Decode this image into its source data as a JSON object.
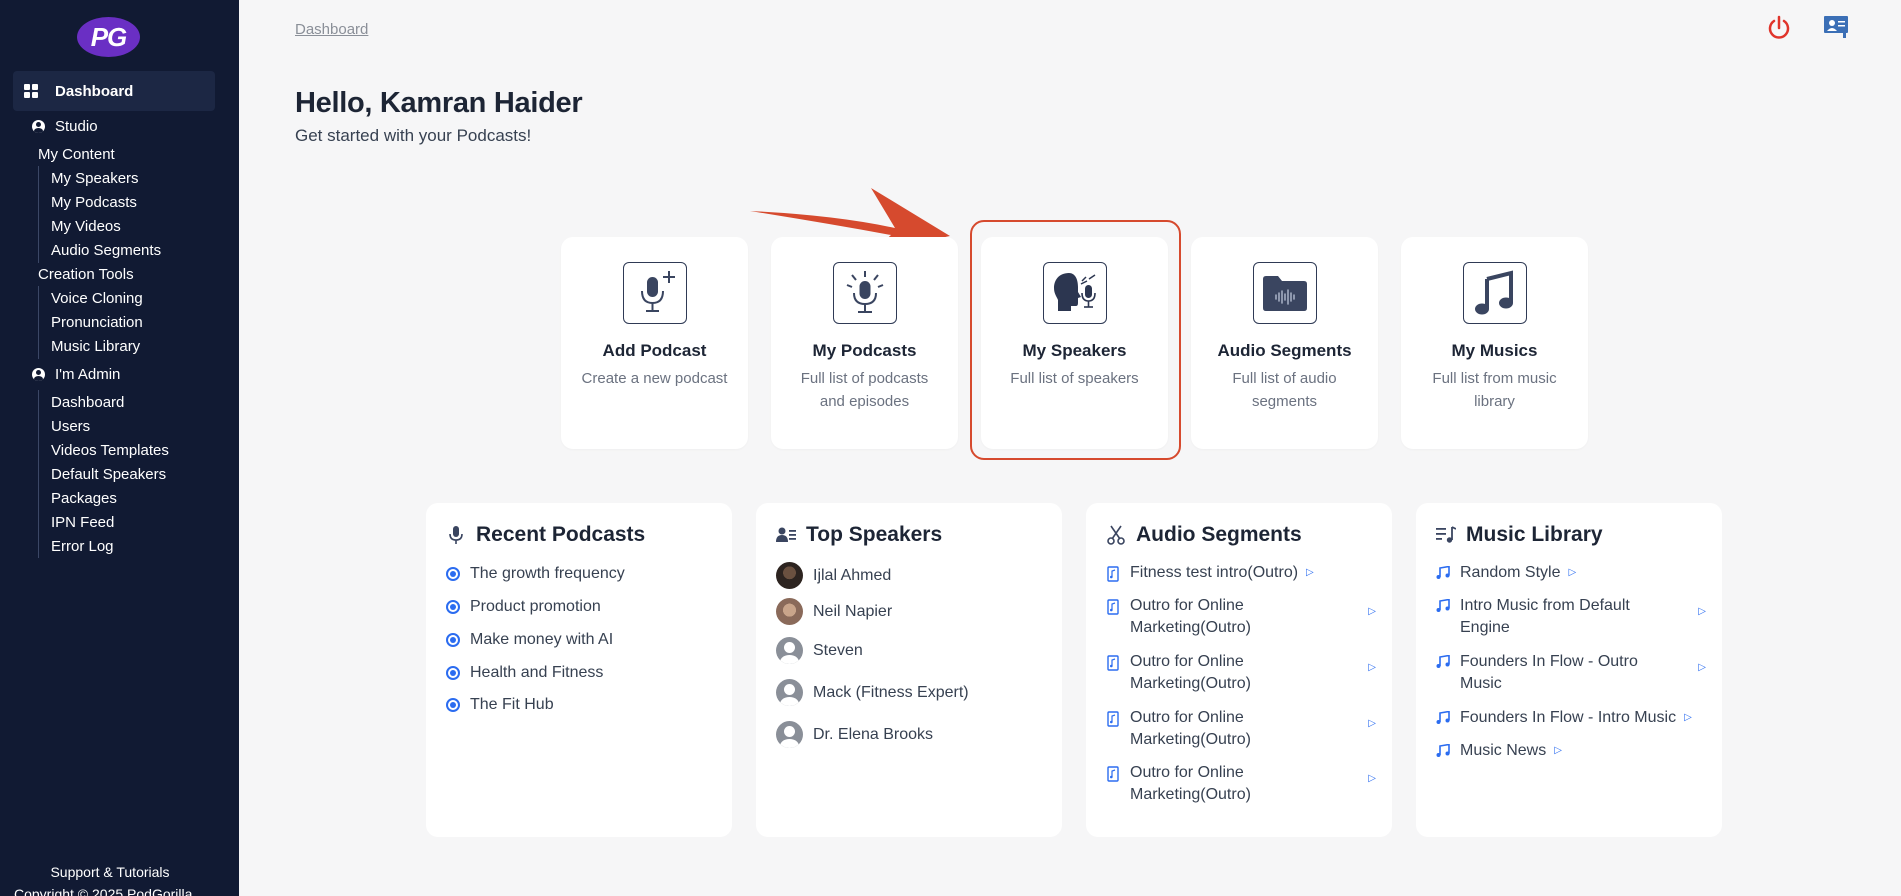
{
  "sidebar": {
    "logo": "PG",
    "dashboard": "Dashboard",
    "studio": "Studio",
    "my_content": "My Content",
    "content_items": [
      "My Speakers",
      "My Podcasts",
      "My Videos",
      "Audio Segments"
    ],
    "creation_tools": "Creation Tools",
    "tool_items": [
      "Voice Cloning",
      "Pronunciation",
      "Music Library"
    ],
    "admin": "I'm Admin",
    "admin_items": [
      "Dashboard",
      "Users",
      "Videos Templates",
      "Default Speakers",
      "Packages",
      "IPN Feed",
      "Error Log"
    ],
    "support": "Support & Tutorials",
    "copyright": "Copyright © 2025 PodGorilla"
  },
  "header": {
    "breadcrumb": "Dashboard",
    "greeting": "Hello, Kamran Haider",
    "subtitle": "Get started with your Podcasts!"
  },
  "quick_cards": [
    {
      "title": "Add Podcast",
      "desc": "Create a new podcast",
      "icon": "mic-plus-icon"
    },
    {
      "title": "My Podcasts",
      "desc": "Full list of podcasts and episodes",
      "icon": "mic-broadcast-icon"
    },
    {
      "title": "My Speakers",
      "desc": "Full list of speakers",
      "icon": "speaker-head-icon"
    },
    {
      "title": "Audio Segments",
      "desc": "Full list of audio segments",
      "icon": "audio-folder-icon"
    },
    {
      "title": "My Musics",
      "desc": "Full list from music library",
      "icon": "music-note-icon"
    }
  ],
  "recent_podcasts": {
    "title": "Recent Podcasts",
    "items": [
      "The growth frequency",
      "Product promotion",
      "Make money with AI",
      "Health and Fitness",
      "The Fit Hub"
    ]
  },
  "top_speakers": {
    "title": "Top Speakers",
    "items": [
      "Ijlal Ahmed",
      "Neil Napier",
      "Steven",
      "Mack (Fitness Expert)",
      "Dr. Elena Brooks"
    ]
  },
  "audio_segments": {
    "title": "Audio Segments",
    "items": [
      "Fitness test intro(Outro)",
      "Outro for Online Marketing(Outro)",
      "Outro for Online Marketing(Outro)",
      "Outro for Online Marketing(Outro)",
      "Outro for Online Marketing(Outro)"
    ]
  },
  "music_library": {
    "title": "Music Library",
    "items": [
      "Random Style",
      "Intro Music from Default Engine",
      "Founders In Flow - Outro Music",
      "Founders In Flow - Intro Music",
      "Music News"
    ]
  },
  "colors": {
    "sidebar_bg": "#111a33",
    "accent_blue": "#2b6cf0",
    "highlight_red": "#d64a2e",
    "logo_purple": "#6a2fc4"
  }
}
